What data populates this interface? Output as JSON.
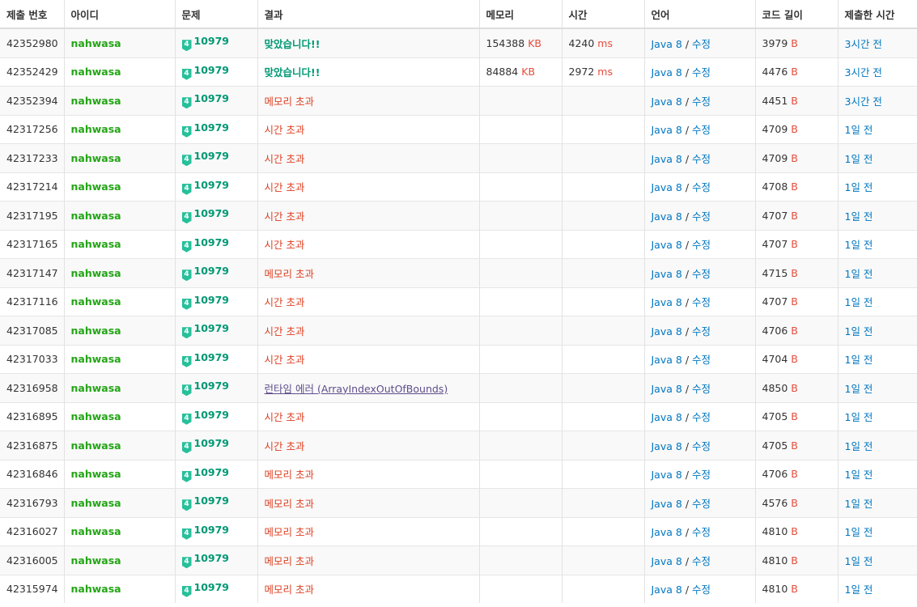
{
  "headers": [
    "제출 번호",
    "아이디",
    "문제",
    "결과",
    "메모리",
    "시간",
    "언어",
    "코드 길이",
    "제출한 시간"
  ],
  "lang_label": "Java 8",
  "edit_label": "수정",
  "badge_level": "4",
  "rows": [
    {
      "id": "42352980",
      "user": "nahwasa",
      "problem": "10979",
      "result": "맞았습니다!!",
      "rtype": "ac",
      "memory": "154388",
      "mem_unit": "KB",
      "time": "4240",
      "time_unit": "ms",
      "length": "3979",
      "len_unit": "B",
      "submitted": "3시간 전"
    },
    {
      "id": "42352429",
      "user": "nahwasa",
      "problem": "10979",
      "result": "맞았습니다!!",
      "rtype": "ac",
      "memory": "84884",
      "mem_unit": "KB",
      "time": "2972",
      "time_unit": "ms",
      "length": "4476",
      "len_unit": "B",
      "submitted": "3시간 전"
    },
    {
      "id": "42352394",
      "user": "nahwasa",
      "problem": "10979",
      "result": "메모리 초과",
      "rtype": "err",
      "memory": "",
      "mem_unit": "",
      "time": "",
      "time_unit": "",
      "length": "4451",
      "len_unit": "B",
      "submitted": "3시간 전"
    },
    {
      "id": "42317256",
      "user": "nahwasa",
      "problem": "10979",
      "result": "시간 초과",
      "rtype": "err",
      "memory": "",
      "mem_unit": "",
      "time": "",
      "time_unit": "",
      "length": "4709",
      "len_unit": "B",
      "submitted": "1일 전"
    },
    {
      "id": "42317233",
      "user": "nahwasa",
      "problem": "10979",
      "result": "시간 초과",
      "rtype": "err",
      "memory": "",
      "mem_unit": "",
      "time": "",
      "time_unit": "",
      "length": "4709",
      "len_unit": "B",
      "submitted": "1일 전"
    },
    {
      "id": "42317214",
      "user": "nahwasa",
      "problem": "10979",
      "result": "시간 초과",
      "rtype": "err",
      "memory": "",
      "mem_unit": "",
      "time": "",
      "time_unit": "",
      "length": "4708",
      "len_unit": "B",
      "submitted": "1일 전"
    },
    {
      "id": "42317195",
      "user": "nahwasa",
      "problem": "10979",
      "result": "시간 초과",
      "rtype": "err",
      "memory": "",
      "mem_unit": "",
      "time": "",
      "time_unit": "",
      "length": "4707",
      "len_unit": "B",
      "submitted": "1일 전"
    },
    {
      "id": "42317165",
      "user": "nahwasa",
      "problem": "10979",
      "result": "시간 초과",
      "rtype": "err",
      "memory": "",
      "mem_unit": "",
      "time": "",
      "time_unit": "",
      "length": "4707",
      "len_unit": "B",
      "submitted": "1일 전"
    },
    {
      "id": "42317147",
      "user": "nahwasa",
      "problem": "10979",
      "result": "메모리 초과",
      "rtype": "err",
      "memory": "",
      "mem_unit": "",
      "time": "",
      "time_unit": "",
      "length": "4715",
      "len_unit": "B",
      "submitted": "1일 전"
    },
    {
      "id": "42317116",
      "user": "nahwasa",
      "problem": "10979",
      "result": "시간 초과",
      "rtype": "err",
      "memory": "",
      "mem_unit": "",
      "time": "",
      "time_unit": "",
      "length": "4707",
      "len_unit": "B",
      "submitted": "1일 전"
    },
    {
      "id": "42317085",
      "user": "nahwasa",
      "problem": "10979",
      "result": "시간 초과",
      "rtype": "err",
      "memory": "",
      "mem_unit": "",
      "time": "",
      "time_unit": "",
      "length": "4706",
      "len_unit": "B",
      "submitted": "1일 전"
    },
    {
      "id": "42317033",
      "user": "nahwasa",
      "problem": "10979",
      "result": "시간 초과",
      "rtype": "err",
      "memory": "",
      "mem_unit": "",
      "time": "",
      "time_unit": "",
      "length": "4704",
      "len_unit": "B",
      "submitted": "1일 전"
    },
    {
      "id": "42316958",
      "user": "nahwasa",
      "problem": "10979",
      "result": "런타임 에러 (ArrayIndexOutOfBounds)",
      "rtype": "rte",
      "memory": "",
      "mem_unit": "",
      "time": "",
      "time_unit": "",
      "length": "4850",
      "len_unit": "B",
      "submitted": "1일 전"
    },
    {
      "id": "42316895",
      "user": "nahwasa",
      "problem": "10979",
      "result": "시간 초과",
      "rtype": "err",
      "memory": "",
      "mem_unit": "",
      "time": "",
      "time_unit": "",
      "length": "4705",
      "len_unit": "B",
      "submitted": "1일 전"
    },
    {
      "id": "42316875",
      "user": "nahwasa",
      "problem": "10979",
      "result": "시간 초과",
      "rtype": "err",
      "memory": "",
      "mem_unit": "",
      "time": "",
      "time_unit": "",
      "length": "4705",
      "len_unit": "B",
      "submitted": "1일 전"
    },
    {
      "id": "42316846",
      "user": "nahwasa",
      "problem": "10979",
      "result": "메모리 초과",
      "rtype": "err",
      "memory": "",
      "mem_unit": "",
      "time": "",
      "time_unit": "",
      "length": "4706",
      "len_unit": "B",
      "submitted": "1일 전"
    },
    {
      "id": "42316793",
      "user": "nahwasa",
      "problem": "10979",
      "result": "메모리 초과",
      "rtype": "err",
      "memory": "",
      "mem_unit": "",
      "time": "",
      "time_unit": "",
      "length": "4576",
      "len_unit": "B",
      "submitted": "1일 전"
    },
    {
      "id": "42316027",
      "user": "nahwasa",
      "problem": "10979",
      "result": "메모리 초과",
      "rtype": "err",
      "memory": "",
      "mem_unit": "",
      "time": "",
      "time_unit": "",
      "length": "4810",
      "len_unit": "B",
      "submitted": "1일 전"
    },
    {
      "id": "42316005",
      "user": "nahwasa",
      "problem": "10979",
      "result": "메모리 초과",
      "rtype": "err",
      "memory": "",
      "mem_unit": "",
      "time": "",
      "time_unit": "",
      "length": "4810",
      "len_unit": "B",
      "submitted": "1일 전"
    },
    {
      "id": "42315974",
      "user": "nahwasa",
      "problem": "10979",
      "result": "메모리 초과",
      "rtype": "err",
      "memory": "",
      "mem_unit": "",
      "time": "",
      "time_unit": "",
      "length": "4810",
      "len_unit": "B",
      "submitted": "1일 전"
    }
  ],
  "colors": {
    "accepted": "#009874",
    "error": "#dd4124",
    "user": "#23a515",
    "link": "#0076c0",
    "unit": "#e74c3c",
    "badge": "#27c09b"
  }
}
